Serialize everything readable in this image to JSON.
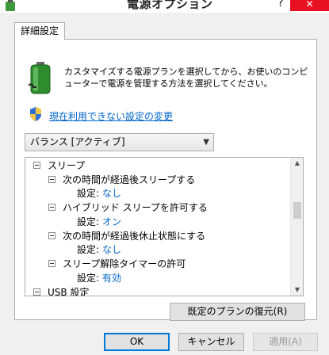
{
  "window": {
    "title": "電源オプション",
    "help_label": "?",
    "close_label": "✕"
  },
  "tab": {
    "label": "詳細設定"
  },
  "description": "カスタマイズする電源プランを選択してから、お使いのコンピューターで電源を管理する方法を選択してください。",
  "link": {
    "label": "現在利用できない設定の変更"
  },
  "plan_select": {
    "selected": "バランス [アクティブ]"
  },
  "tree": {
    "sleep": "スリープ",
    "sleep_after": "次の時間が経過後スリープする",
    "sleep_after_setting": "設定:",
    "sleep_after_value": "なし",
    "hybrid": "ハイブリッド スリープを許可する",
    "hybrid_setting": "設定:",
    "hybrid_value": "オン",
    "hibernate": "次の時間が経過後休止状態にする",
    "hibernate_setting": "設定:",
    "hibernate_value": "なし",
    "wake_timers": "スリープ解除タイマーの許可",
    "wake_timers_setting": "設定:",
    "wake_timers_value": "有効",
    "usb": "USB 設定"
  },
  "buttons": {
    "restore": "既定のプランの復元(R)",
    "ok": "OK",
    "cancel": "キャンセル",
    "apply": "適用(A)"
  },
  "colors": {
    "close": "#e81123",
    "link": "#0066cc",
    "focus": "#0078d7"
  }
}
